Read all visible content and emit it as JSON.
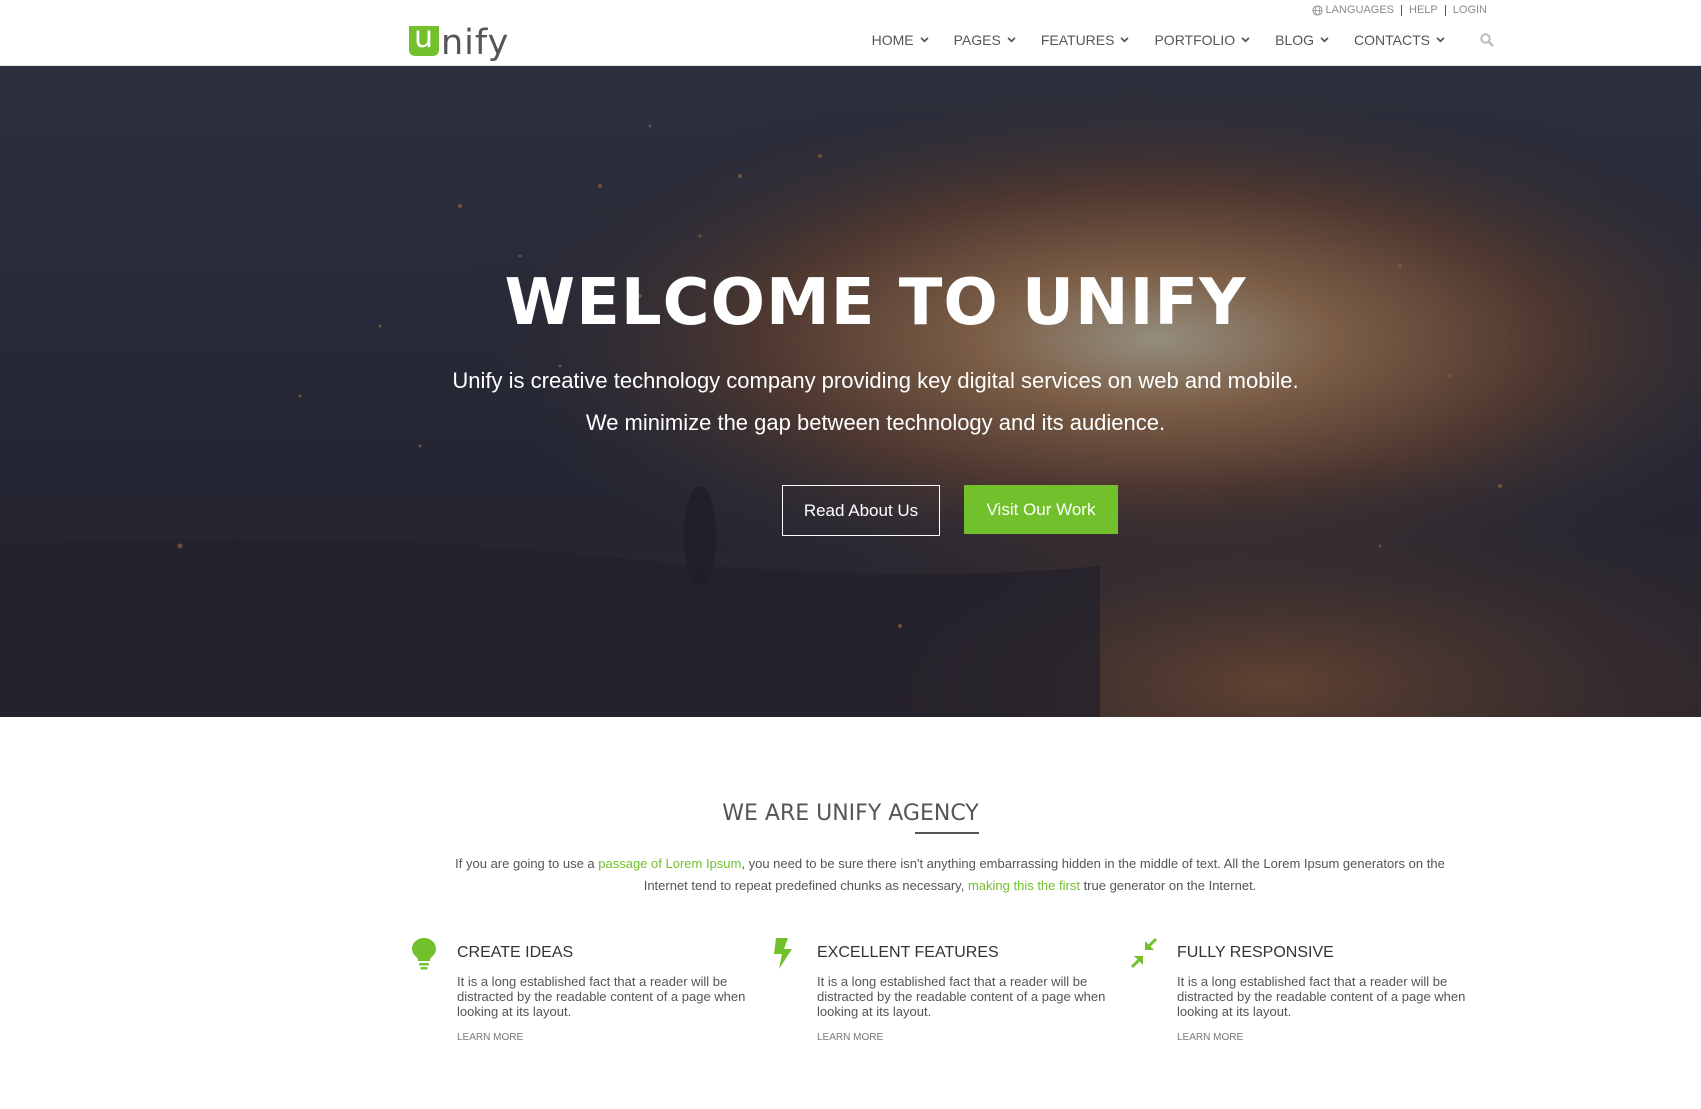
{
  "brand": {
    "logo_letter": "u",
    "logo_rest": "nify",
    "accent_color": "#72c02c"
  },
  "topbar": {
    "languages": "LANGUAGES",
    "help": "HELP",
    "login": "LOGIN"
  },
  "nav": {
    "items": [
      {
        "label": "HOME"
      },
      {
        "label": "PAGES"
      },
      {
        "label": "FEATURES"
      },
      {
        "label": "PORTFOLIO"
      },
      {
        "label": "BLOG"
      },
      {
        "label": "CONTACTS"
      }
    ],
    "search_icon": "search-icon"
  },
  "hero": {
    "title": "WELCOME TO UNIFY",
    "subtitle_line1": "Unify is creative technology company providing key digital services on web and mobile.",
    "subtitle_line2": "We minimize the gap between technology and its audience.",
    "primary_button": "Read About Us",
    "secondary_button": "Visit Our Work"
  },
  "agency": {
    "title": "WE ARE UNIFY AGENCY",
    "text_part1": "If you are going to use a ",
    "link1": "passage of Lorem Ipsum",
    "text_part2": ", you need to be sure there isn't anything embarrassing hidden in the middle of text. All the Lorem Ipsum generators on the Internet tend to repeat predefined chunks as necessary, ",
    "link2": "making this the first",
    "text_part3": " true generator on the Internet."
  },
  "features": [
    {
      "icon": "lightbulb-icon",
      "title": "CREATE IDEAS",
      "text": "It is a long established fact that a reader will be distracted by the readable content of a page when looking at its layout.",
      "link": "LEARN MORE"
    },
    {
      "icon": "lightning-bolt-icon",
      "title": "EXCELLENT FEATURES",
      "text": "It is a long established fact that a reader will be distracted by the readable content of a page when looking at its layout.",
      "link": "LEARN MORE"
    },
    {
      "icon": "compress-arrows-icon",
      "title": "FULLY RESPONSIVE",
      "text": "It is a long established fact that a reader will be distracted by the readable content of a page when looking at its layout.",
      "link": "LEARN MORE"
    }
  ]
}
